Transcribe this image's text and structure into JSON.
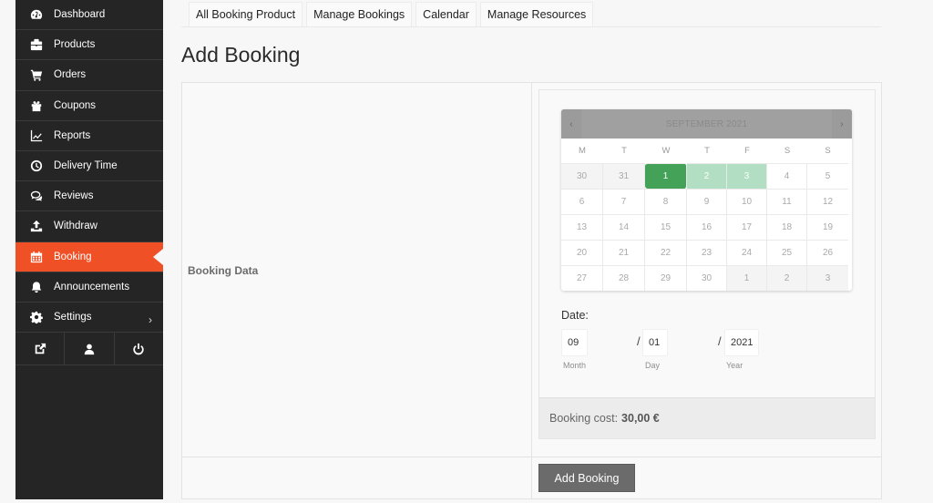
{
  "sidebar": {
    "items": [
      {
        "label": "Dashboard",
        "icon": "dashboard-icon"
      },
      {
        "label": "Products",
        "icon": "briefcase-icon"
      },
      {
        "label": "Orders",
        "icon": "cart-icon"
      },
      {
        "label": "Coupons",
        "icon": "gift-icon"
      },
      {
        "label": "Reports",
        "icon": "chart-line-icon"
      },
      {
        "label": "Delivery Time",
        "icon": "clock-icon"
      },
      {
        "label": "Reviews",
        "icon": "comments-icon"
      },
      {
        "label": "Withdraw",
        "icon": "upload-icon"
      },
      {
        "label": "Booking",
        "icon": "calendar-icon",
        "active": true
      },
      {
        "label": "Announcements",
        "icon": "bell-icon"
      },
      {
        "label": "Settings",
        "icon": "gear-icon",
        "chevron": "›"
      }
    ],
    "bottom": [
      "external-link-icon",
      "user-icon",
      "power-icon"
    ]
  },
  "tabs": [
    "All Booking Product",
    "Manage Bookings",
    "Calendar",
    "Manage Resources"
  ],
  "page_title": "Add Booking",
  "form": {
    "row_label": "Booking Data",
    "calendar": {
      "month_label": "SEPTEMBER 2021",
      "prev": "‹",
      "next": "›",
      "weekdays": [
        "M",
        "T",
        "W",
        "T",
        "F",
        "S",
        "S"
      ],
      "weeks": [
        [
          {
            "d": "30",
            "s": "other"
          },
          {
            "d": "31",
            "s": "other"
          },
          {
            "d": "1",
            "s": "selected"
          },
          {
            "d": "2",
            "s": "range"
          },
          {
            "d": "3",
            "s": "range"
          },
          {
            "d": "4",
            "s": ""
          },
          {
            "d": "5",
            "s": ""
          }
        ],
        [
          {
            "d": "6",
            "s": ""
          },
          {
            "d": "7",
            "s": ""
          },
          {
            "d": "8",
            "s": ""
          },
          {
            "d": "9",
            "s": ""
          },
          {
            "d": "10",
            "s": ""
          },
          {
            "d": "11",
            "s": ""
          },
          {
            "d": "12",
            "s": ""
          }
        ],
        [
          {
            "d": "13",
            "s": ""
          },
          {
            "d": "14",
            "s": ""
          },
          {
            "d": "15",
            "s": ""
          },
          {
            "d": "16",
            "s": ""
          },
          {
            "d": "17",
            "s": ""
          },
          {
            "d": "18",
            "s": ""
          },
          {
            "d": "19",
            "s": ""
          }
        ],
        [
          {
            "d": "20",
            "s": ""
          },
          {
            "d": "21",
            "s": ""
          },
          {
            "d": "22",
            "s": ""
          },
          {
            "d": "23",
            "s": ""
          },
          {
            "d": "24",
            "s": ""
          },
          {
            "d": "25",
            "s": ""
          },
          {
            "d": "26",
            "s": ""
          }
        ],
        [
          {
            "d": "27",
            "s": ""
          },
          {
            "d": "28",
            "s": ""
          },
          {
            "d": "29",
            "s": ""
          },
          {
            "d": "30",
            "s": ""
          },
          {
            "d": "1",
            "s": "other"
          },
          {
            "d": "2",
            "s": "other"
          },
          {
            "d": "3",
            "s": "other"
          }
        ]
      ]
    },
    "date": {
      "label": "Date:",
      "month": {
        "value": "09",
        "label": "Month"
      },
      "day": {
        "value": "01",
        "label": "Day"
      },
      "year": {
        "value": "2021",
        "label": "Year"
      },
      "separator": "/"
    },
    "cost": {
      "label": "Booking cost:",
      "value": "30,00 €"
    },
    "submit_label": "Add Booking"
  },
  "colors": {
    "accent": "#f05025",
    "sidebar_bg": "#252525",
    "selected_day": "#43a158",
    "range_day": "#b2dfc3"
  }
}
